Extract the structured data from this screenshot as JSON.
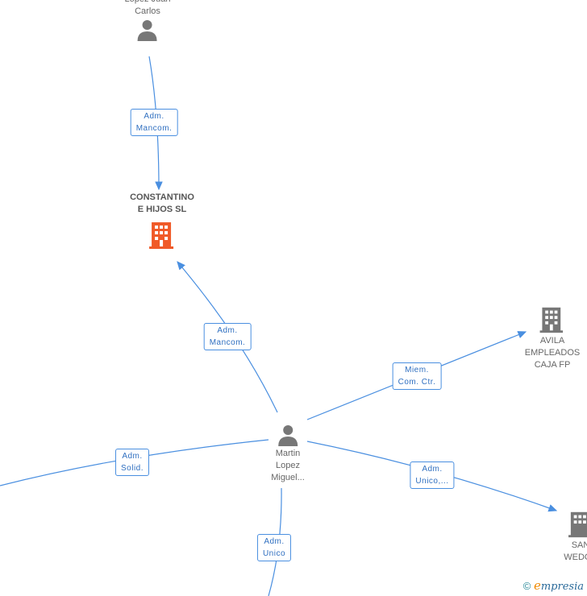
{
  "nodes": {
    "lopez": {
      "name": "Lopez Juan\nCarlos",
      "type": "person"
    },
    "constantino": {
      "name": "CONSTANTINO\nE HIJOS SL",
      "type": "company-main"
    },
    "martin": {
      "name": "Martin\nLopez\nMiguel...",
      "type": "person"
    },
    "avila": {
      "name": "AVILA\nEMPLEADOS\nCAJA FP",
      "type": "company"
    },
    "san": {
      "name": "SAN\nWEDGE",
      "type": "company"
    }
  },
  "edges": [
    {
      "label": "Adm.\nMancom."
    },
    {
      "label": "Adm.\nMancom."
    },
    {
      "label": "Miem.\nCom. Ctr."
    },
    {
      "label": "Adm.\nUnico,..."
    },
    {
      "label": "Adm.\nSolid."
    },
    {
      "label": "Adm.\nUnico"
    }
  ],
  "colors": {
    "edge": "#4a8fe0",
    "main_company": "#f05a28",
    "node": "#777777"
  },
  "footer": {
    "copyright": "©",
    "brand_e": "e",
    "brand_rest": "mpresia"
  }
}
